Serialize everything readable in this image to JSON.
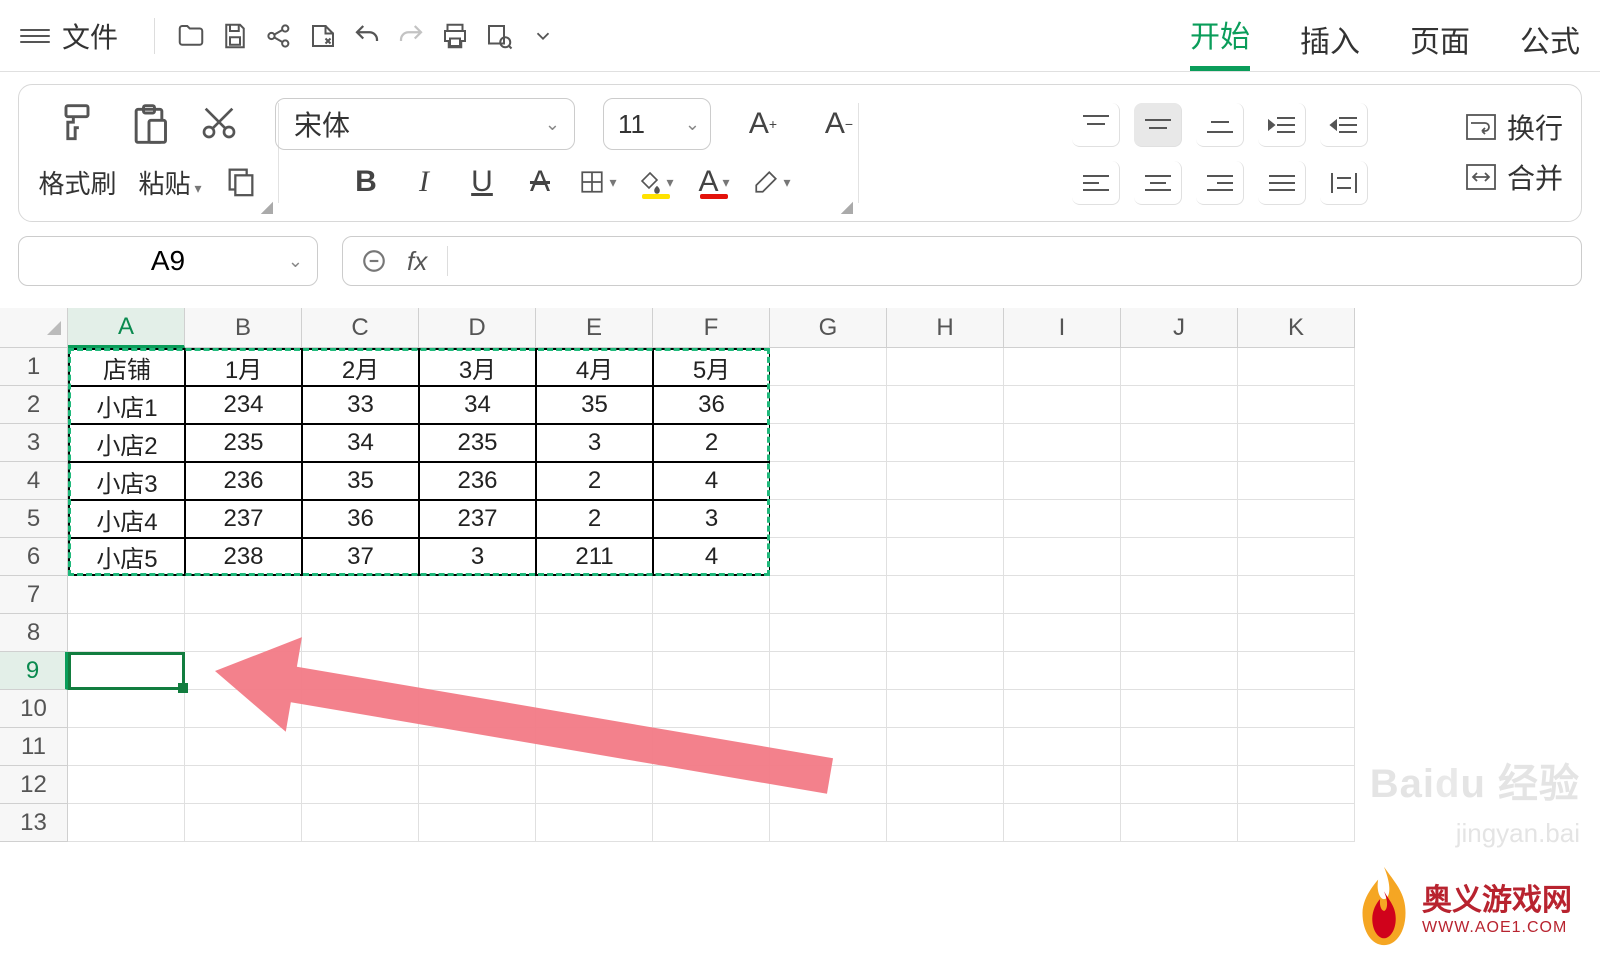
{
  "menu": {
    "file": "文件",
    "tabs": {
      "start": "开始",
      "insert": "插入",
      "page": "页面",
      "formula": "公式"
    }
  },
  "ribbon": {
    "format_painter": "格式刷",
    "paste": "粘贴",
    "font_name": "宋体",
    "font_size": "11",
    "wrap_text": "换行",
    "merge": "合并"
  },
  "namebox": "A9",
  "fx_label": "fx",
  "columns": [
    "A",
    "B",
    "C",
    "D",
    "E",
    "F",
    "G",
    "H",
    "I",
    "J",
    "K"
  ],
  "row_numbers": [
    "1",
    "2",
    "3",
    "4",
    "5",
    "6",
    "7",
    "8",
    "9",
    "10",
    "11",
    "12",
    "13"
  ],
  "active_col_index": 0,
  "active_row_index": 8,
  "chart_data": {
    "type": "table",
    "headers": [
      "店铺",
      "1月",
      "2月",
      "3月",
      "4月",
      "5月"
    ],
    "rows": [
      [
        "小店1",
        "234",
        "33",
        "34",
        "35",
        "36"
      ],
      [
        "小店2",
        "235",
        "34",
        "235",
        "3",
        "2"
      ],
      [
        "小店3",
        "236",
        "35",
        "236",
        "2",
        "4"
      ],
      [
        "小店4",
        "237",
        "36",
        "237",
        "2",
        "3"
      ],
      [
        "小店5",
        "238",
        "37",
        "3",
        "211",
        "4"
      ]
    ]
  },
  "watermark": {
    "brand": "Bai",
    "brand2": "经验",
    "sub": "jingyan.bai"
  },
  "sitelogo": {
    "cn": "奥义游戏网",
    "en": "WWW.AOE1.COM"
  }
}
